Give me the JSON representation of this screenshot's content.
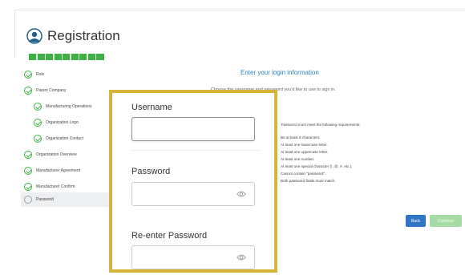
{
  "header": {
    "title": "Registration",
    "logo_icon": "user-circle-icon"
  },
  "progress": {
    "segments_total": 9,
    "segments_complete": 9,
    "color": "#3cb043"
  },
  "sidebar": {
    "items": [
      {
        "label": "Role",
        "status": "complete",
        "indent": false
      },
      {
        "label": "Parent Company",
        "status": "complete",
        "indent": false
      },
      {
        "label": "Manufacturing Operations",
        "status": "complete",
        "indent": true
      },
      {
        "label": "Organization Logo",
        "status": "complete",
        "indent": true
      },
      {
        "label": "Organization Contact",
        "status": "complete",
        "indent": true
      },
      {
        "label": "Organization Overview",
        "status": "complete",
        "indent": false
      },
      {
        "label": "Manufacturer Agreement",
        "status": "complete",
        "indent": false
      },
      {
        "label": "Manufacturer Confirm",
        "status": "complete",
        "indent": false
      },
      {
        "label": "Password",
        "status": "current",
        "indent": false
      }
    ]
  },
  "main": {
    "title": "Enter your login information",
    "subtitle": "Choose the username and password you'd like to use to sign in.",
    "requirements_heading": "Password must meet the following requirements:",
    "requirements": [
      "Be at least 8 characters.",
      "At least one lowercase letter.",
      "At least one uppercase letter.",
      "At least one number.",
      "At least one special character (!, @, #, etc.).",
      "Cannot contain \"password\".",
      "Both password fields must match."
    ],
    "back_label": "Back",
    "continue_label": "Continue"
  },
  "form": {
    "username_label": "Username",
    "username_value": "",
    "password_label": "Password",
    "password_value": "",
    "reenter_label": "Re-enter Password",
    "reenter_value": "",
    "eye_icon": "eye-icon"
  },
  "colors": {
    "accent": "#2e86c1",
    "success": "#3cb043",
    "highlight_border": "#d4b43a",
    "back_button": "#2e75c7",
    "continue_button": "#a6dba5"
  }
}
